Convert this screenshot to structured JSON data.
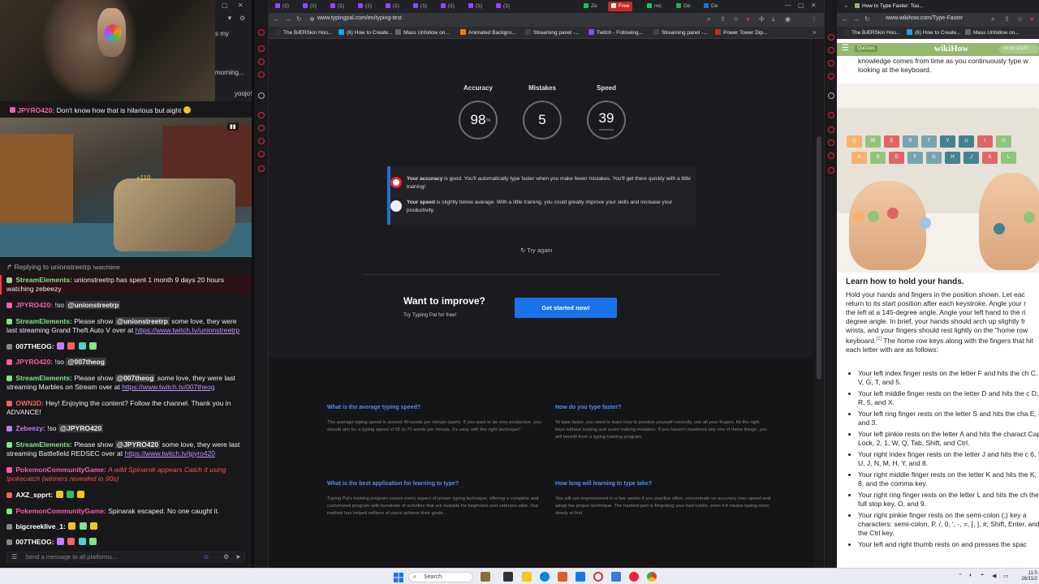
{
  "left_panel": {
    "side_text": [
      "s my",
      "morning...",
      "yoojo!Haha"
    ],
    "pinned": {
      "user": "JPYRO420:",
      "text": "Don't know how that is hilarious but aight"
    },
    "game_hud": {
      "points": "+110"
    },
    "reply_note": {
      "label": "Replying to unionstreetrp",
      "extra": "!watchtime"
    },
    "messages": [
      {
        "user": "StreamElements:",
        "text": "unionstreetrp has spent 1 month 9 days 20 hours watching zebeezy"
      },
      {
        "user": "JPYRO420:",
        "text": "!so",
        "mention": "@unionstreetrp"
      },
      {
        "user": "StreamElements:",
        "text_a": "Please show",
        "mention": "@unionstreetrp",
        "text_b": "some love, they were last streaming Grand Theft Auto V over at",
        "link": "https://www.twitch.tv/unionstreetrp"
      },
      {
        "user": "007THEOG:"
      },
      {
        "user": "JPYRO420:",
        "text": "!so",
        "mention": "@007theog"
      },
      {
        "user": "StreamElements:",
        "text_a": "Please show",
        "mention": "@007theog",
        "text_b": "some love, they were last streaming Marbles on Stream over at",
        "link": "https://www.twitch.tv/007theog"
      },
      {
        "user": "OWN3D:",
        "text": "Hey! Enjoying the content? Follow the channel. Thank you in ADVANCE!"
      },
      {
        "user": "Zebeezy:",
        "text": "!so",
        "mention": "@JPYRO420"
      },
      {
        "user": "StreamElements:",
        "text_a": "Please show",
        "mention": "@JPYRO420",
        "text_b": "some love, they were last streaming Battlefield REDSEC over at",
        "link": "https://www.twitch.tv/jpyro420"
      },
      {
        "user": "PokemonCommunityGame:",
        "text": "A wild Spinarok appears",
        "text_b": "Catch it using !pokecatch (winners revealed in 90s)"
      },
      {
        "user": "AXZ_spprt:"
      },
      {
        "user": "PokemonCommunityGame:",
        "text": "Spinarak escaped. No one caught it."
      },
      {
        "user": "bigcreekIive_1:"
      },
      {
        "user": "007THEOG:"
      }
    ],
    "chat_input_placeholder": "Send a message to all platforms..."
  },
  "mid_browser": {
    "tabs": [
      "(1)",
      "(1)",
      "(1)",
      "(1)",
      "(1)",
      "(1)",
      "(1)",
      "(1)",
      "(1)",
      "Ze",
      "Free",
      "rec",
      "Ge",
      "De"
    ],
    "url": "www.typingpal.com/en/typing-test",
    "bookmarks": [
      "The BÆRSkin Hoo...",
      "(6) How to Create...",
      "Mass Unfollow on...",
      "Animated Backgro...",
      "Streaming panel -...",
      "Twitch - Following...",
      "Streaming panel -...",
      "Power Tower Dip..."
    ],
    "stats": [
      {
        "label": "Accuracy",
        "value": "98",
        "unit": "%"
      },
      {
        "label": "Mistakes",
        "value": "5",
        "unit": ""
      },
      {
        "label": "Speed",
        "value": "39",
        "unit": "words/min"
      }
    ],
    "feedback": {
      "accuracy_strong": "Your accuracy",
      "accuracy_text": "is good. You'll automatically type faster when you make fewer mistakes. You'll get there quickly with a little training!",
      "speed_strong": "Your speed",
      "speed_text": "is slightly below average. With a little training, you could greatly improve your skills and increase your productivity."
    },
    "try_again": "Try again",
    "improve": {
      "title": "Want to improve?",
      "subtitle": "Try Typing Pal for free!",
      "cta": "Get started now!"
    },
    "faq": [
      {
        "q": "What is the average typing speed?",
        "a": "The average typing speed is around 40 words per minute (wpm). If you want to be very productive, you should aim for a typing speed of 65 to 70 words per minute. It's easy with the right technique!"
      },
      {
        "q": "How do you type faster?",
        "a": "To type faster, you need to learn how to position yourself correctly, use all your fingers, hit the right keys without looking and avoid making mistakes. If you haven't mastered any one of these things, you will benefit from a typing training program."
      },
      {
        "q": "What is the best application for learning to type?",
        "a": "Typing Pal's training program covers every aspect of proper typing technique, offering a complete and customized program with hundreds of activities that are suitable for beginners and veterans alike. Our method has helped millions of users achieve their goals."
      },
      {
        "q": "How long will learning to type take?",
        "a": "You will see improvement in a few weeks if you practice often, concentrate on accuracy over speed and adopt the proper technique. The hardest part is forgetting your bad habits, even if it means typing more slowly at first."
      }
    ]
  },
  "right_browser": {
    "tab_title": "How to Type Faster: Tou...",
    "url": "www.wikihow.com/Type-Faster",
    "bookmarks": [
      "The BÆRSkin Hoo...",
      "(6) How to Create...",
      "Mass Unfollow on..."
    ],
    "logo": "wikiHow",
    "header_badge": "Quizzes",
    "search_placeholder": "to do anyth",
    "top_text": "knowledge comes from time as you continuously type w looking at the keyboard.",
    "section_title": "Learn how to hold your hands.",
    "body": "Hold your hands and fingers in the position shown. Let eac return to its start position after each keystroke. Angle your r the left at a 145-degree angle. Angle your left hand to the ri degree angle. In brief, your hands should arch up slightly fr wrists, and your fingers should rest lightly on the \"home row keyboard.",
    "body_sup": "[2]",
    "body_tail": "The home row keys along with the fingers that hit each letter with are as follows:",
    "list": [
      "Your left index finger rests on the letter F and hits the ch C, V, G, T, and 5.",
      "Your left middle finger rests on the letter D and hits the c D, R, 5, and X.",
      "Your left ring finger rests on the letter S and hits the cha E, 4, and 3.",
      "Your left pinkie rests on the letter A and hits the charact Caps Lock, 2, 1, W, Q, Tab, Shift, and Ctrl.",
      "Your right index finger rests on the letter J and hits the c 6, 7, U, J, N, M, H, Y, and 8.",
      "Your right middle finger rests on the letter K and hits the K, I, 8, and the comma key.",
      "Your right ring finger rests on the letter L and hits the ch the full stop key, O, and 9.",
      "Your right pinkie finger rests on the semi-colon (;) key a characters: semi-colon, P, /, 0, ', -, =, [, ], #, Shift, Enter, and the Ctrl key.",
      "Your left and right thumb rests on and presses the spac"
    ],
    "keyboard_keys": [
      "Q",
      "W",
      "E",
      "R",
      "T",
      "Y",
      "U",
      "I",
      "O",
      "A",
      "S",
      "D",
      "F",
      "G",
      "H",
      "J",
      "K",
      "L"
    ]
  },
  "taskbar": {
    "search": "Search",
    "time": "11:0",
    "date": "26/11/2"
  },
  "colors": {
    "accent_blue": "#1a73e8",
    "link_blue": "#4d8ff5",
    "wikihow_green": "#93b874",
    "twitch_purple": "#bf94ff"
  }
}
